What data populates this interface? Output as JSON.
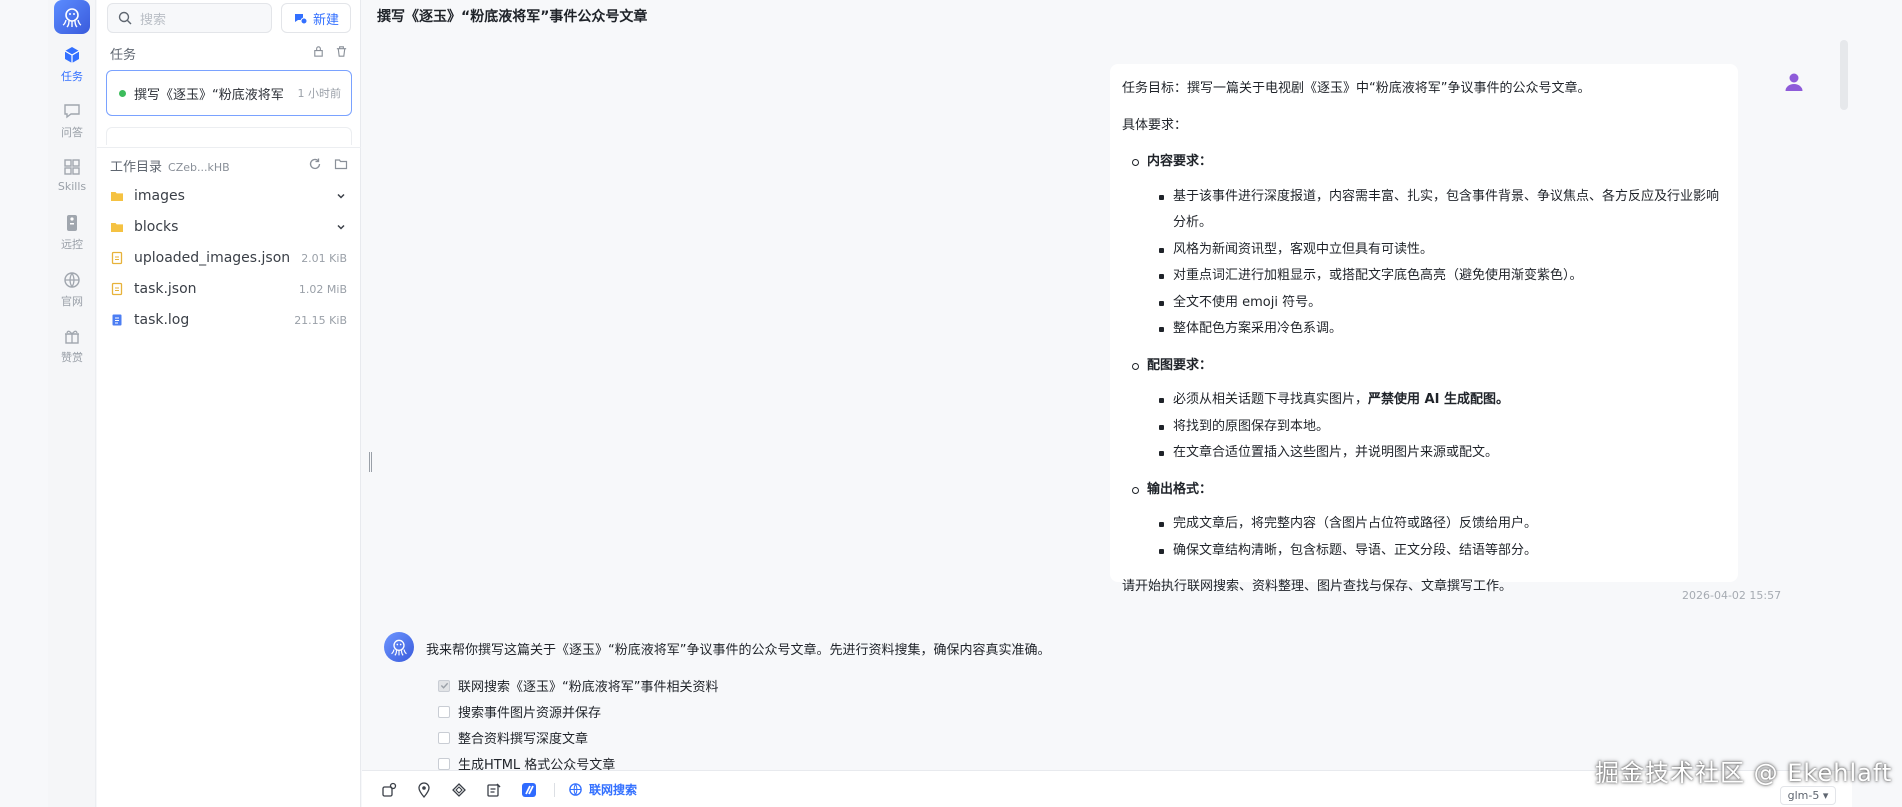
{
  "colors": {
    "accent": "#3370ff",
    "status_dot": "#3cbc5c",
    "bubble_bg": "#ffffff",
    "page_bg": "#f7f8fa"
  },
  "rail": {
    "items": [
      {
        "label": "任务",
        "icon": "cube-icon"
      },
      {
        "label": "问答",
        "icon": "chat-icon"
      },
      {
        "label": "Skills",
        "icon": "grid-icon"
      },
      {
        "label": "远控",
        "icon": "remote-icon"
      },
      {
        "label": "官网",
        "icon": "globe-icon"
      },
      {
        "label": "赞赏",
        "icon": "gift-icon"
      }
    ]
  },
  "sidebar": {
    "search_placeholder": "搜索",
    "new_label": "新建",
    "tasks_title": "任务",
    "task": {
      "title": "撰写《逐玉》“粉底液将军”事件公众号文章",
      "time": "1 小时前"
    },
    "workdir_title": "工作目录",
    "workdir_id": "CZeb...kHB",
    "files": [
      {
        "name": "images",
        "type": "folder"
      },
      {
        "name": "blocks",
        "type": "folder"
      },
      {
        "name": "uploaded_images.json",
        "size": "2.01 KiB",
        "type": "json"
      },
      {
        "name": "task.json",
        "size": "1.02 MiB",
        "type": "json"
      },
      {
        "name": "task.log",
        "size": "21.15 KiB",
        "type": "log"
      }
    ]
  },
  "main": {
    "title": "撰写《逐玉》“粉底液将军”事件公众号文章",
    "user_message": {
      "goal": "任务目标：撰写一篇关于电视剧《逐玉》中“粉底液将军”争议事件的公众号文章。",
      "req_title": "具体要求：",
      "sections": [
        {
          "title": "内容要求：",
          "items": [
            "基于该事件进行深度报道，内容需丰富、扎实，包含事件背景、争议焦点、各方反应及行业影响分析。",
            "风格为新闻资讯型，客观中立但具有可读性。",
            "对重点词汇进行加粗显示，或搭配文字底色高亮（避免使用渐变紫色）。",
            "全文不使用 emoji 符号。",
            "整体配色方案采用冷色系调。"
          ]
        },
        {
          "title": "配图要求：",
          "items": [
            "必须从相关话题下寻找真实图片，",
            "将找到的原图保存到本地。",
            "在文章合适位置插入这些图片，并说明图片来源或配文。"
          ],
          "bold_tail": "严禁使用 AI 生成配图。"
        },
        {
          "title": "输出格式：",
          "items": [
            "完成文章后，将完整内容（含图片占位符或路径）反馈给用户。",
            "确保文章结构清晰，包含标题、导语、正文分段、结语等部分。"
          ]
        }
      ],
      "closing": "请开始执行联网搜索、资料整理、图片查找与保存、文章撰写工作。",
      "timestamp": "2026-04-02 15:57"
    },
    "bot_message": "我来帮你撰写这篇关于《逐玉》“粉底液将军”争议事件的公众号文章。先进行资料搜集，确保内容真实准确。",
    "todos": [
      {
        "text": "联网搜索《逐玉》“粉底液将军”事件相关资料",
        "checked": true
      },
      {
        "text": "搜索事件图片资源并保存",
        "checked": false
      },
      {
        "text": "整合资料撰写深度文章",
        "checked": false
      },
      {
        "text": "生成HTML 格式公众号文章",
        "checked": false
      }
    ],
    "toolbar": {
      "web_search_label": "联网搜索",
      "model": "glm-5 ▾"
    }
  },
  "watermark": "掘金技术社区 @ Ekehlaft"
}
